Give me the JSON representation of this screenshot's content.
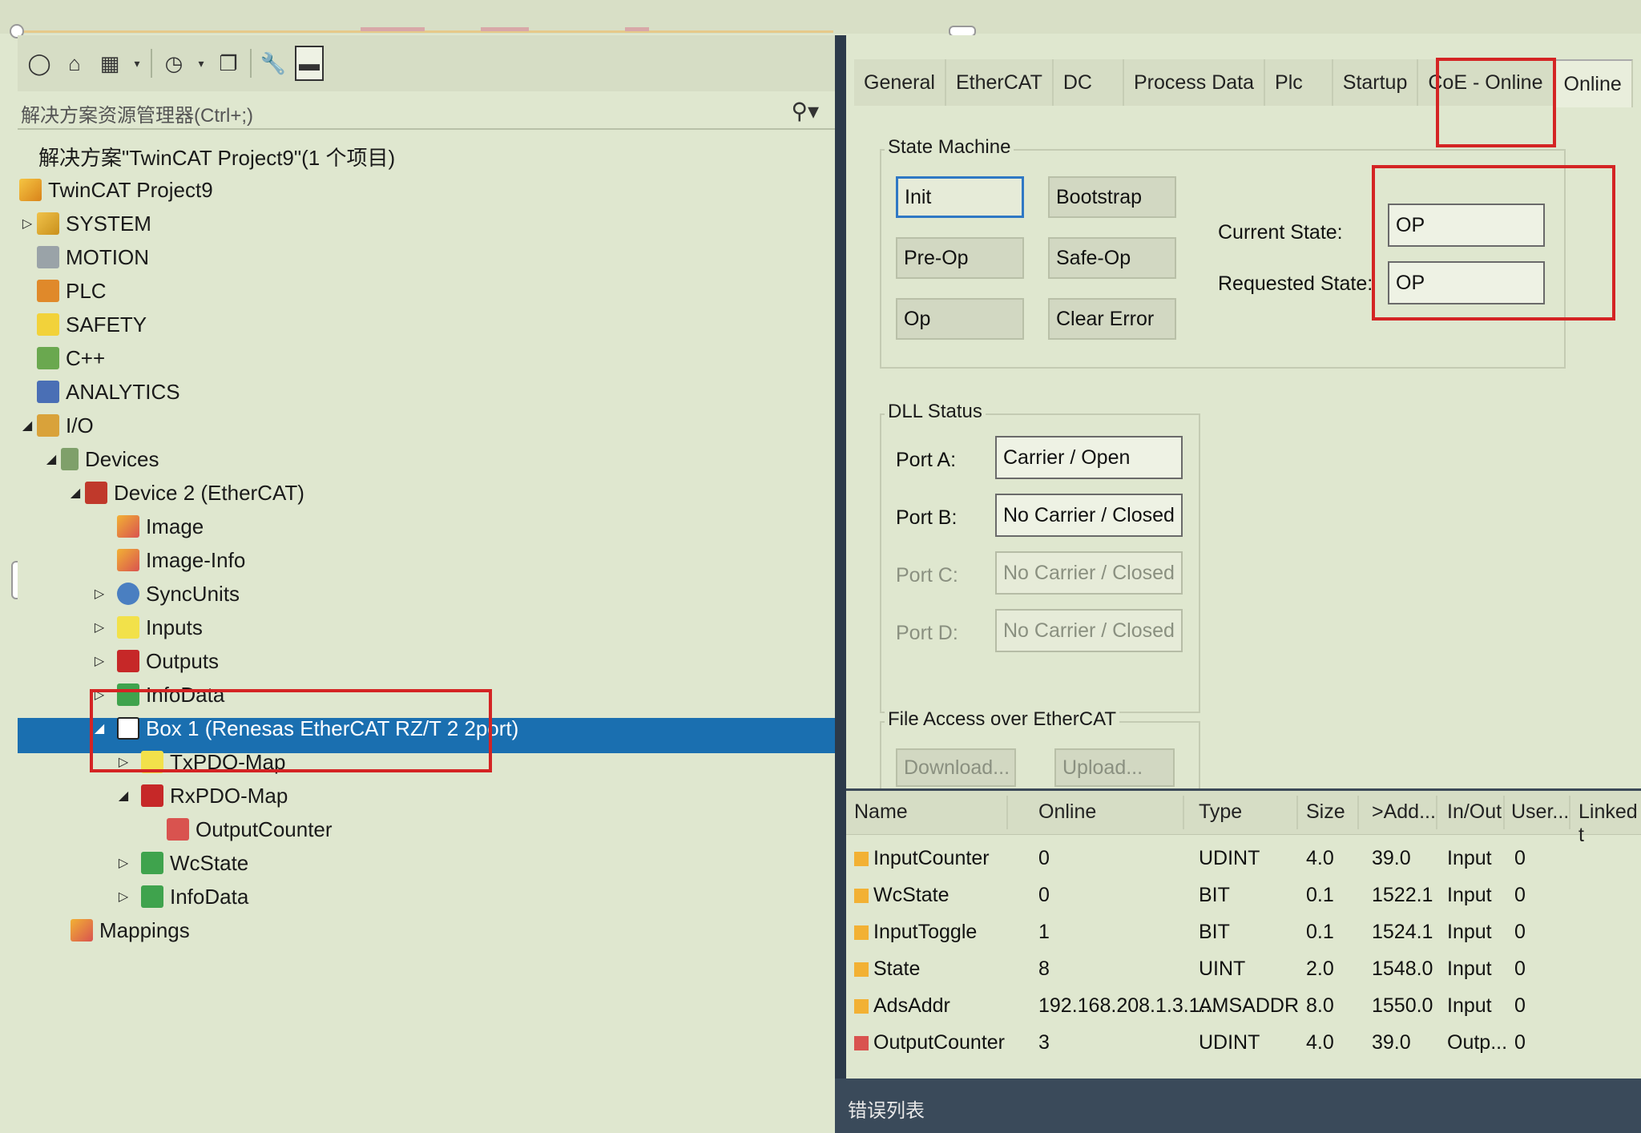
{
  "solution_explorer": {
    "search_placeholder": "解决方案资源管理器(Ctrl+;)",
    "nodes": [
      {
        "label": "解决方案\"TwinCAT Project9\"(1 个项目)",
        "expander": ""
      },
      {
        "label": "TwinCAT Project9",
        "expander": ""
      },
      {
        "label": "SYSTEM",
        "expander": "▷"
      },
      {
        "label": "MOTION",
        "expander": ""
      },
      {
        "label": "PLC",
        "expander": ""
      },
      {
        "label": "SAFETY",
        "expander": ""
      },
      {
        "label": "C++",
        "expander": ""
      },
      {
        "label": "ANALYTICS",
        "expander": ""
      },
      {
        "label": "I/O",
        "expander": "◢"
      },
      {
        "label": "Devices",
        "expander": "◢"
      },
      {
        "label": "Device 2 (EtherCAT)",
        "expander": "◢"
      },
      {
        "label": "Image",
        "expander": ""
      },
      {
        "label": "Image-Info",
        "expander": ""
      },
      {
        "label": "SyncUnits",
        "expander": "▷"
      },
      {
        "label": "Inputs",
        "expander": "▷"
      },
      {
        "label": "Outputs",
        "expander": "▷"
      },
      {
        "label": "InfoData",
        "expander": "▷"
      },
      {
        "label": "Box 1 (Renesas EtherCAT RZ/T 2 2port)",
        "expander": "◢"
      },
      {
        "label": "TxPDO-Map",
        "expander": "▷"
      },
      {
        "label": "RxPDO-Map",
        "expander": "◢"
      },
      {
        "label": "OutputCounter",
        "expander": ""
      },
      {
        "label": "WcState",
        "expander": "▷"
      },
      {
        "label": "InfoData",
        "expander": "▷"
      },
      {
        "label": "Mappings",
        "expander": ""
      }
    ]
  },
  "tabs": [
    "General",
    "EtherCAT",
    "DC",
    "Process Data",
    "Plc",
    "Startup",
    "CoE - Online",
    "Online"
  ],
  "state_machine": {
    "title": "State Machine",
    "buttons": [
      "Init",
      "Bootstrap",
      "Pre-Op",
      "Safe-Op",
      "Op",
      "Clear Error"
    ],
    "current_state_label": "Current State:",
    "current_state_value": "OP",
    "requested_state_label": "Requested State:",
    "requested_state_value": "OP"
  },
  "dll_status": {
    "title": "DLL Status",
    "ports": [
      {
        "label": "Port A:",
        "value": "Carrier / Open"
      },
      {
        "label": "Port B:",
        "value": "No Carrier / Closed"
      },
      {
        "label": "Port C:",
        "value": "No Carrier / Closed"
      },
      {
        "label": "Port D:",
        "value": "No Carrier / Closed"
      }
    ]
  },
  "file_access": {
    "title": "File Access over EtherCAT",
    "download_label": "Download...",
    "upload_label": "Upload..."
  },
  "variables_table": {
    "headers": [
      "Name",
      "Online",
      "Type",
      "Size",
      ">Add...",
      "In/Out",
      "User...",
      "Linked t"
    ],
    "rows": [
      [
        "InputCounter",
        "0",
        "UDINT",
        "4.0",
        "39.0",
        "Input",
        "0"
      ],
      [
        "WcState",
        "0",
        "BIT",
        "0.1",
        "1522.1",
        "Input",
        "0"
      ],
      [
        "InputToggle",
        "1",
        "BIT",
        "0.1",
        "1524.1",
        "Input",
        "0"
      ],
      [
        "State",
        "8",
        "UINT",
        "2.0",
        "1548.0",
        "Input",
        "0"
      ],
      [
        "AdsAddr",
        "192.168.208.1.3.1...",
        "AMSADDR",
        "8.0",
        "1550.0",
        "Input",
        "0"
      ],
      [
        "OutputCounter",
        "3",
        "UDINT",
        "4.0",
        "39.0",
        "Outp...",
        "0"
      ]
    ]
  },
  "bottom_panel": {
    "title": "错误列表"
  },
  "colors": {
    "selection": "#1a6fb0",
    "highlight_box": "#d42424",
    "background": "#dfe7cf"
  }
}
